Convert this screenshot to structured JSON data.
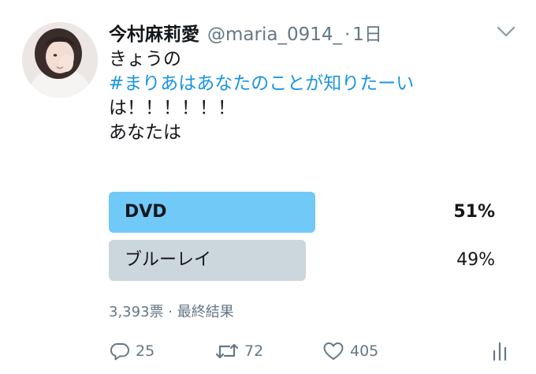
{
  "tweet": {
    "display_name": "今村麻莉愛",
    "handle": "@maria_0914_",
    "separator": "·",
    "time": "1日",
    "lines": {
      "l1": "きょうの",
      "hashtag": "#まりあはあなたのことが知りたーい",
      "l3": "は！！！！！！",
      "l4": "あなたは"
    }
  },
  "poll": {
    "options": [
      {
        "label": "DVD",
        "percent": "51%",
        "percent_value": 51,
        "winner": true
      },
      {
        "label": "ブルーレイ",
        "percent": "49%",
        "percent_value": 49,
        "winner": false
      }
    ],
    "meta": "3,393票 · 最終結果"
  },
  "actions": {
    "reply_count": "25",
    "retweet_count": "72",
    "like_count": "405"
  },
  "icons": {
    "caret": "chevron-down-icon",
    "reply": "reply-icon",
    "retweet": "retweet-icon",
    "like": "heart-icon",
    "stats": "analytics-icon"
  },
  "colors": {
    "hashtag": "#1b95e0",
    "winner_bar": "#71c9f8",
    "loser_bar": "#ccd6dd",
    "secondary_text": "#657786"
  }
}
